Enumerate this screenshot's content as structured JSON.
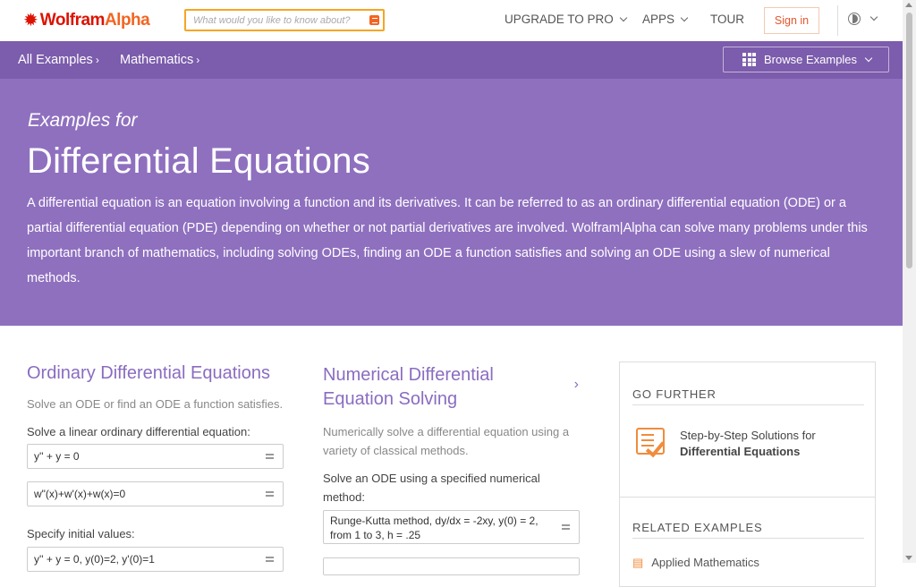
{
  "brand": {
    "wolfram": "Wolfram",
    "alpha": "Alpha"
  },
  "search": {
    "placeholder": "What would you like to know about?"
  },
  "nav": {
    "upgrade": "UPGRADE TO PRO",
    "apps": "APPS",
    "tour": "TOUR",
    "signin": "Sign in"
  },
  "breadcrumb": {
    "items": [
      "All Examples",
      "Mathematics"
    ],
    "separator": "›"
  },
  "browse": {
    "label": "Browse Examples"
  },
  "hero": {
    "pre": "Examples for",
    "title": "Differential Equations",
    "description": "A differential equation is an equation involving a function and its derivatives. It can be referred to as an ordinary differential equation (ODE) or a partial differential equation (PDE) depending on whether or not partial derivatives are involved. Wolfram|Alpha can solve many problems under this important branch of mathematics, including solving ODEs, finding an ODE a function satisfies and solving an ODE using a slew of numerical methods."
  },
  "ode": {
    "title": "Ordinary Differential Equations",
    "description": "Solve an ODE or find an ODE a function satisfies.",
    "label1": "Solve a linear ordinary differential equation:",
    "examples": [
      "y'' + y = 0",
      "w\"(x)+w'(x)+w(x)=0"
    ],
    "label2": "Specify initial values:",
    "examples2": [
      "y'' + y = 0, y(0)=2, y'(0)=1"
    ]
  },
  "numerical": {
    "title": "Numerical Differential Equation Solving",
    "arrow": "›",
    "description": "Numerically solve a differential equation using a variety of classical methods.",
    "label1": "Solve an ODE using a specified numerical method:",
    "examples": [
      "Runge-Kutta method, dy/dx = -2xy, y(0) = 2, from 1 to 3, h = .25"
    ]
  },
  "further": {
    "heading": "GO FURTHER",
    "link_line1": "Step-by-Step Solutions for",
    "link_line2": "Differential Equations",
    "related_heading": "RELATED EXAMPLES",
    "related_first": "Applied Mathematics"
  },
  "colors": {
    "subbar": "#7c5cac",
    "hero": "#8f70bf",
    "title_purple": "#8a6cc0",
    "accent_orange": "#f26522"
  }
}
